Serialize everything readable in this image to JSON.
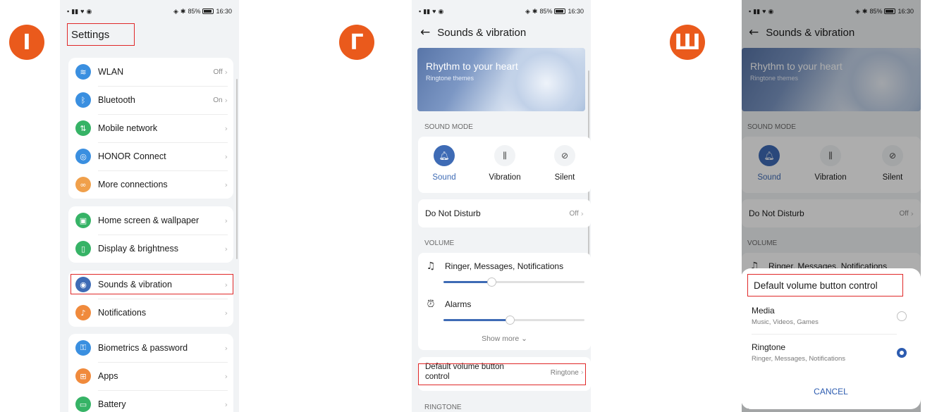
{
  "colors": {
    "badge": "#ea5a1c",
    "highlight": "#e02828",
    "accent": "#3e6bb5"
  },
  "steps": [
    "Ⅰ",
    "Γ",
    "Ш"
  ],
  "status_bar": {
    "battery": "85%",
    "time": "16:30"
  },
  "phone1": {
    "title": "Settings",
    "group1": [
      {
        "label": "WLAN",
        "value": "Off",
        "icon": "wifi-icon",
        "color": "#3a8fe0",
        "glyph": "≋"
      },
      {
        "label": "Bluetooth",
        "value": "On",
        "icon": "bluetooth-icon",
        "color": "#3a8fe0",
        "glyph": "ᛒ"
      },
      {
        "label": "Mobile network",
        "value": "",
        "icon": "mobile-network-icon",
        "color": "#36b366",
        "glyph": "⇅"
      },
      {
        "label": "HONOR Connect",
        "value": "",
        "icon": "honor-connect-icon",
        "color": "#3a8fe0",
        "glyph": "◎"
      },
      {
        "label": "More connections",
        "value": "",
        "icon": "link-icon",
        "color": "#f0a04b",
        "glyph": "∞"
      }
    ],
    "group2": [
      {
        "label": "Home screen & wallpaper",
        "value": "",
        "icon": "wallpaper-icon",
        "color": "#36b366",
        "glyph": "▣"
      },
      {
        "label": "Display & brightness",
        "value": "",
        "icon": "display-icon",
        "color": "#36b366",
        "glyph": "▯"
      }
    ],
    "group3": [
      {
        "label": "Sounds & vibration",
        "value": "",
        "icon": "sound-icon",
        "color": "#3e6bb5",
        "glyph": "◉"
      },
      {
        "label": "Notifications",
        "value": "",
        "icon": "bell-icon",
        "color": "#f08a3c",
        "glyph": "♪"
      }
    ],
    "group4": [
      {
        "label": "Biometrics & password",
        "value": "",
        "icon": "key-icon",
        "color": "#3a8fe0",
        "glyph": "⚿"
      },
      {
        "label": "Apps",
        "value": "",
        "icon": "apps-icon",
        "color": "#f08a3c",
        "glyph": "⊞"
      },
      {
        "label": "Battery",
        "value": "",
        "icon": "battery-icon",
        "color": "#36b366",
        "glyph": "▭"
      }
    ]
  },
  "sounds": {
    "header": "Sounds & vibration",
    "banner_title": "Rhythm to your heart",
    "banner_sub": "Ringtone themes",
    "sound_mode_label": "SOUND MODE",
    "modes": [
      {
        "label": "Sound",
        "icon": "bell-icon",
        "active": true
      },
      {
        "label": "Vibration",
        "icon": "vibration-icon",
        "active": false
      },
      {
        "label": "Silent",
        "icon": "bell-off-icon",
        "active": false
      }
    ],
    "dnd_label": "Do Not Disturb",
    "dnd_value": "Off",
    "volume_label": "VOLUME",
    "ringer_label": "Ringer, Messages, Notifications",
    "ringer_level": 0.34,
    "alarms_label": "Alarms",
    "alarms_level": 0.47,
    "show_more": "Show more",
    "dvbc_label": "Default volume button control",
    "dvbc_value": "Ringtone",
    "ringtone_label": "RINGTONE"
  },
  "dialog": {
    "title": "Default volume button control",
    "options": [
      {
        "title": "Media",
        "sub": "Music, Videos, Games",
        "selected": false
      },
      {
        "title": "Ringtone",
        "sub": "Ringer, Messages, Notifications",
        "selected": true
      }
    ],
    "cancel": "CANCEL"
  }
}
